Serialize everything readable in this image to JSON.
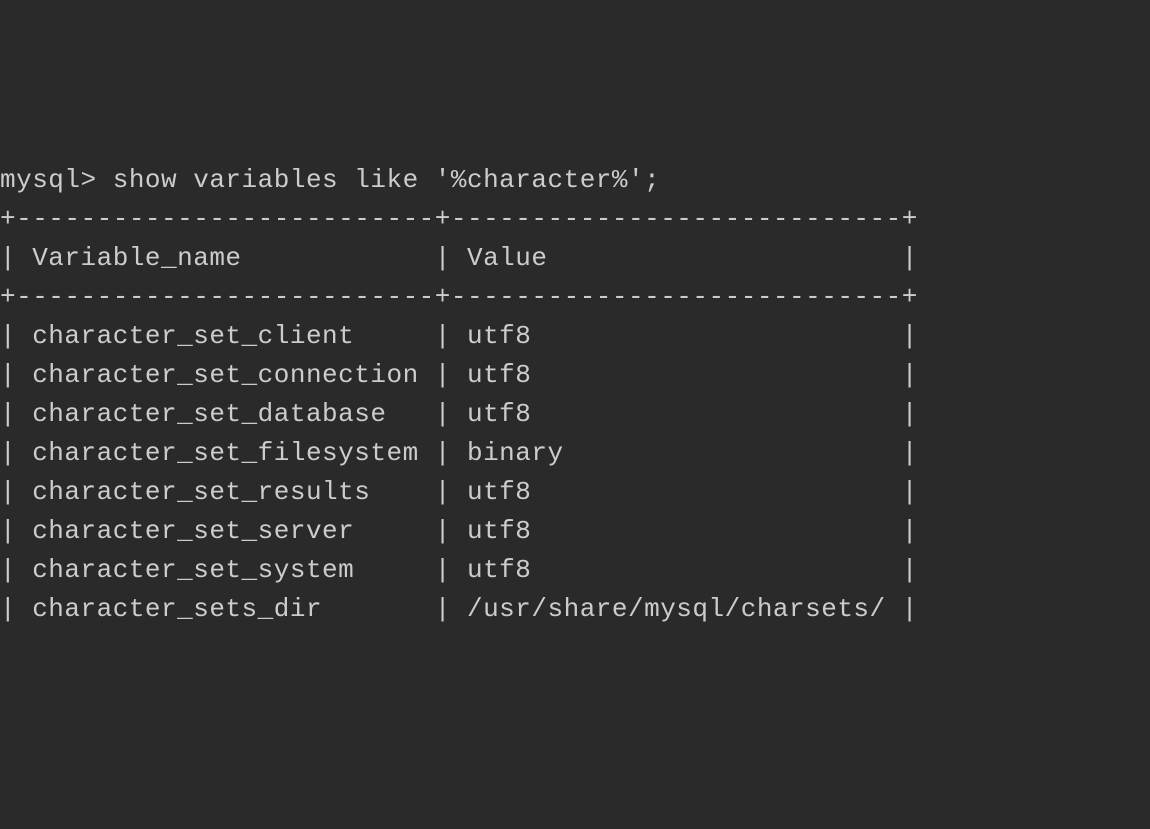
{
  "prompt": "mysql> ",
  "command": "show variables like '%character%';",
  "border_top": "+--------------------------+----------------------------+",
  "border_mid": "+--------------------------+----------------------------+",
  "header_line": "| Variable_name            | Value                      |",
  "rows": [
    {
      "line": "| character_set_client     | utf8                       |"
    },
    {
      "line": "| character_set_connection | utf8                       |"
    },
    {
      "line": "| character_set_database   | utf8                       |"
    },
    {
      "line": "| character_set_filesystem | binary                     |"
    },
    {
      "line": "| character_set_results    | utf8                       |"
    },
    {
      "line": "| character_set_server     | utf8                       |"
    },
    {
      "line": "| character_set_system     | utf8                       |"
    },
    {
      "line": "| character_sets_dir       | /usr/share/mysql/charsets/ |"
    }
  ],
  "table_data": {
    "columns": [
      "Variable_name",
      "Value"
    ],
    "rows": [
      [
        "character_set_client",
        "utf8"
      ],
      [
        "character_set_connection",
        "utf8"
      ],
      [
        "character_set_database",
        "utf8"
      ],
      [
        "character_set_filesystem",
        "binary"
      ],
      [
        "character_set_results",
        "utf8"
      ],
      [
        "character_set_server",
        "utf8"
      ],
      [
        "character_set_system",
        "utf8"
      ],
      [
        "character_sets_dir",
        "/usr/share/mysql/charsets/"
      ]
    ]
  }
}
